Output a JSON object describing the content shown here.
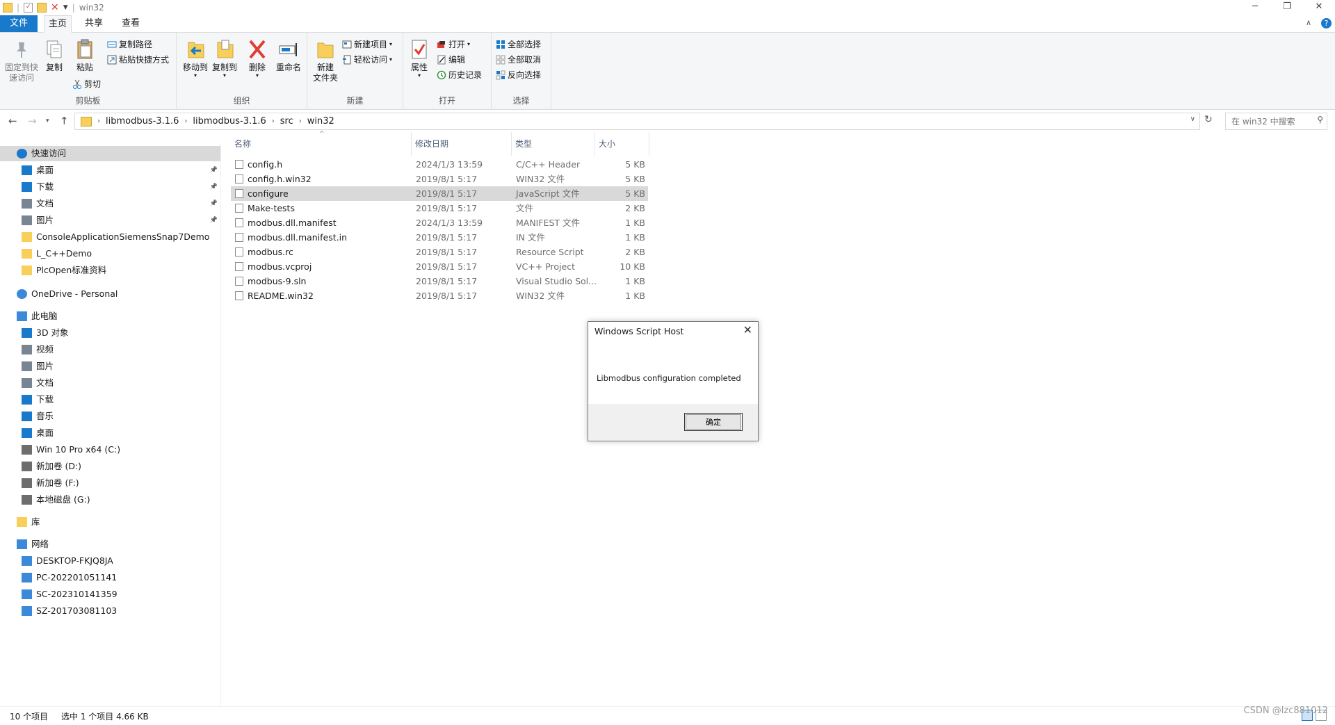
{
  "window": {
    "title": "win32",
    "min": "─",
    "max": "❐",
    "close": "✕"
  },
  "ribbon_tabs": [
    {
      "label": "文件"
    },
    {
      "label": "主页"
    },
    {
      "label": "共享"
    },
    {
      "label": "查看"
    }
  ],
  "ribbon": {
    "clipboard": {
      "group_label": "剪贴板",
      "pin_label_1": "固定到快",
      "pin_label_2": "速访问",
      "copy_label": "复制",
      "paste_label": "粘贴",
      "copy_path": "复制路径",
      "paste_shortcut": "粘贴快捷方式",
      "cut": "剪切"
    },
    "organize": {
      "group_label": "组织",
      "move_to": "移动到",
      "copy_to": "复制到",
      "delete": "删除",
      "rename": "重命名"
    },
    "new": {
      "group_label": "新建",
      "new_folder_1": "新建",
      "new_folder_2": "文件夹",
      "new_item": "新建项目",
      "easy_access": "轻松访问"
    },
    "open": {
      "group_label": "打开",
      "properties": "属性",
      "open": "打开",
      "edit": "编辑",
      "history": "历史记录"
    },
    "select": {
      "group_label": "选择",
      "select_all": "全部选择",
      "select_none": "全部取消",
      "invert": "反向选择"
    }
  },
  "address": {
    "crumbs": [
      "libmodbus-3.1.6",
      "libmodbus-3.1.6",
      "src",
      "win32"
    ],
    "search_placeholder": "在 win32 中搜索"
  },
  "sidebar": {
    "quick_access": "快速访问",
    "quick_items": [
      "桌面",
      "下载",
      "文档",
      "图片",
      "ConsoleApplicationSiemensSnap7Demo",
      "L_C++Demo",
      "PlcOpen标准资料"
    ],
    "onedrive": "OneDrive - Personal",
    "this_pc": "此电脑",
    "pc_items": [
      "3D 对象",
      "视频",
      "图片",
      "文档",
      "下载",
      "音乐",
      "桌面",
      "Win 10 Pro x64 (C:)",
      "新加卷 (D:)",
      "新加卷 (F:)",
      "本地磁盘 (G:)"
    ],
    "library": "库",
    "network": "网络",
    "network_items": [
      "DESKTOP-FKJQ8JA",
      "PC-202201051141",
      "SC-202310141359",
      "SZ-201703081103"
    ]
  },
  "columns": {
    "name": "名称",
    "modified": "修改日期",
    "type": "类型",
    "size": "大小"
  },
  "files": [
    {
      "name": "config.h",
      "modified": "2024/1/3 13:59",
      "type": "C/C++ Header",
      "size": "5 KB"
    },
    {
      "name": "config.h.win32",
      "modified": "2019/8/1 5:17",
      "type": "WIN32 文件",
      "size": "5 KB"
    },
    {
      "name": "configure",
      "modified": "2019/8/1 5:17",
      "type": "JavaScript 文件",
      "size": "5 KB"
    },
    {
      "name": "Make-tests",
      "modified": "2019/8/1 5:17",
      "type": "文件",
      "size": "2 KB"
    },
    {
      "name": "modbus.dll.manifest",
      "modified": "2024/1/3 13:59",
      "type": "MANIFEST 文件",
      "size": "1 KB"
    },
    {
      "name": "modbus.dll.manifest.in",
      "modified": "2019/8/1 5:17",
      "type": "IN 文件",
      "size": "1 KB"
    },
    {
      "name": "modbus.rc",
      "modified": "2019/8/1 5:17",
      "type": "Resource Script",
      "size": "2 KB"
    },
    {
      "name": "modbus.vcproj",
      "modified": "2019/8/1 5:17",
      "type": "VC++ Project",
      "size": "10 KB"
    },
    {
      "name": "modbus-9.sln",
      "modified": "2019/8/1 5:17",
      "type": "Visual Studio Sol...",
      "size": "1 KB"
    },
    {
      "name": "README.win32",
      "modified": "2019/8/1 5:17",
      "type": "WIN32 文件",
      "size": "1 KB"
    }
  ],
  "dialog": {
    "title": "Windows Script Host",
    "message": "Libmodbus configuration completed",
    "ok": "确定"
  },
  "status": {
    "count": "10 个项目",
    "selected": "选中 1 个项目  4.66 KB"
  },
  "watermark": "CSDN @lzc881012",
  "colors": {
    "accent": "#1979ca",
    "selection": "#d9d9d9",
    "folder": "#f7cf5a"
  }
}
